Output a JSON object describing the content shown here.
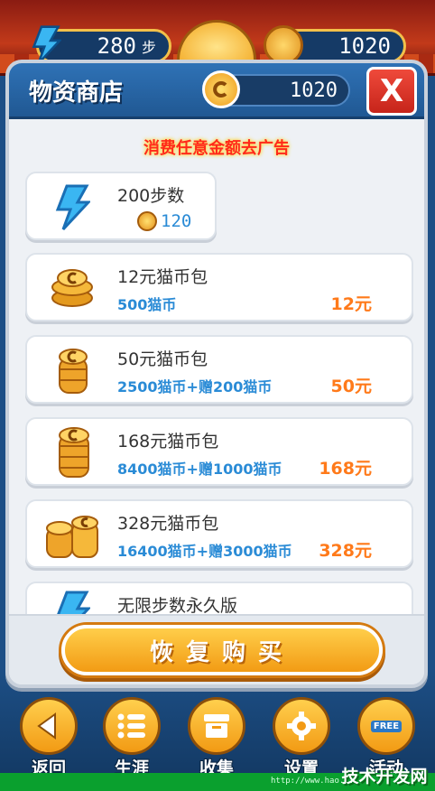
{
  "hud": {
    "steps_value": "280",
    "steps_unit": "步",
    "coins_value": "1020"
  },
  "dialog": {
    "title": "物资商店",
    "balance": "1020",
    "close_label": "X",
    "ad_banner": "消费任意金额去广告"
  },
  "items": [
    {
      "name": "200步数",
      "coin_cost": "120"
    },
    {
      "name": "12元猫币包",
      "desc": "500猫币",
      "price": "12元"
    },
    {
      "name": "50元猫币包",
      "desc": "2500猫币+赠200猫币",
      "price": "50元"
    },
    {
      "name": "168元猫币包",
      "desc": "8400猫币+赠1000猫币",
      "price": "168元"
    },
    {
      "name": "328元猫币包",
      "desc": "16400猫币+赠3000猫币",
      "price": "328元"
    },
    {
      "name": "无限步数永久版"
    }
  ],
  "restore_label": "恢复购买",
  "nav": [
    {
      "label": "返回",
      "icon": "back-arrow-icon"
    },
    {
      "label": "生涯",
      "icon": "list-icon"
    },
    {
      "label": "收集",
      "icon": "box-icon"
    },
    {
      "label": "设置",
      "icon": "gear-icon"
    },
    {
      "label": "活动",
      "icon": "free-ticket-icon",
      "tag": "FREE"
    }
  ],
  "watermark": {
    "url": "http://www.hao...",
    "logo": "技术开发网"
  },
  "colors": {
    "header_blue": "#2f72b6",
    "price_orange": "#ff7a1a",
    "desc_blue": "#2a8bd6",
    "button_orange": "#f29b14",
    "ad_red": "#ff2a1a"
  }
}
